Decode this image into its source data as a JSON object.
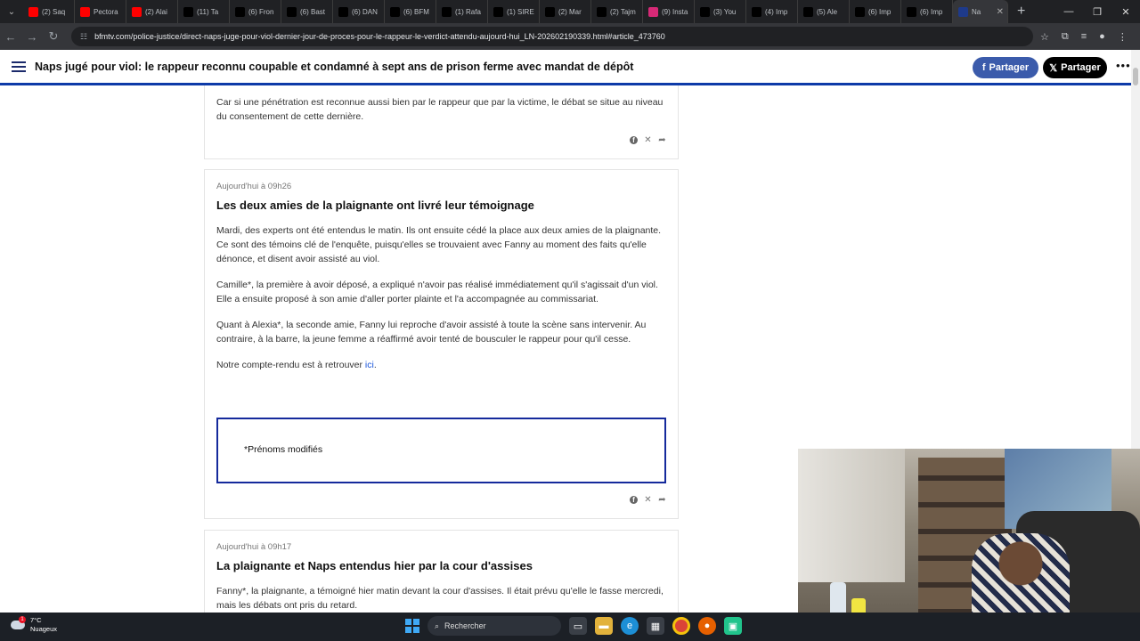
{
  "browser": {
    "tabs": [
      {
        "label": "(2) Saq",
        "color": "#ff0000",
        "icon": "youtube-icon"
      },
      {
        "label": "Pectora",
        "color": "#ff0000",
        "icon": "youtube-icon"
      },
      {
        "label": "(2) Alai",
        "color": "#ff0000",
        "icon": "youtube-icon"
      },
      {
        "label": "(11) Ta",
        "color": "#000000",
        "icon": "x-icon"
      },
      {
        "label": "(6) Fron",
        "color": "#000000",
        "icon": "x-icon"
      },
      {
        "label": "(6) Bast",
        "color": "#000000",
        "icon": "x-icon"
      },
      {
        "label": "(6) DAN",
        "color": "#000000",
        "icon": "x-icon"
      },
      {
        "label": "(6) BFM",
        "color": "#000000",
        "icon": "x-icon"
      },
      {
        "label": "(1) Rafa",
        "color": "#000000",
        "icon": "x-icon"
      },
      {
        "label": "(1) SIRE",
        "color": "#000000",
        "icon": "x-icon"
      },
      {
        "label": "(2) Mar",
        "color": "#000000",
        "icon": "x-icon"
      },
      {
        "label": "(2) Tajm",
        "color": "#000000",
        "icon": "x-icon"
      },
      {
        "label": "(9) Insta",
        "color": "#d62976",
        "icon": "instagram-icon"
      },
      {
        "label": "(3) You",
        "color": "#000000",
        "icon": "x-icon"
      },
      {
        "label": "(4) Imp",
        "color": "#000000",
        "icon": "x-icon"
      },
      {
        "label": "(5) Ale",
        "color": "#000000",
        "icon": "x-icon"
      },
      {
        "label": "(6) Imp",
        "color": "#000000",
        "icon": "x-icon"
      },
      {
        "label": "(6) Imp",
        "color": "#000000",
        "icon": "x-icon"
      },
      {
        "label": "Na",
        "color": "#1e3a8a",
        "icon": "bfm-icon",
        "active": true
      }
    ],
    "new_tab": "+",
    "url": "bfmtv.com/police-justice/direct-naps-juge-pour-viol-dernier-jour-de-proces-pour-le-rappeur-le-verdict-attendu-aujourd-hui_LN-202602190339.html#article_473760"
  },
  "site": {
    "headline": "Naps jugé pour viol: le rappeur reconnu coupable et condamné à sept ans de prison ferme avec mandat de dépôt",
    "share_facebook": "Partager",
    "share_x": "Partager",
    "accent": "#0d3aa8"
  },
  "cards": {
    "first": {
      "paragraph": "Car si une pénétration est reconnue aussi bien par le rappeur que par la victime, le débat se situe au niveau du consentement de cette dernière."
    },
    "second": {
      "time": "Aujourd'hui à 09h26",
      "title": "Les deux amies de la plaignante ont livré leur témoignage",
      "p1": "Mardi, des experts ont été entendus le matin. Ils ont ensuite cédé la place aux deux amies de la plaignante. Ce sont des témoins clé de l'enquête, puisqu'elles se trouvaient avec Fanny au moment des faits qu'elle dénonce, et disent avoir assisté au viol.",
      "p2": "Camille*, la première à avoir déposé, a expliqué n'avoir pas réalisé immédiatement qu'il s'agissait d'un viol. Elle a ensuite proposé à son amie d'aller porter plainte et l'a accompagnée au commissariat.",
      "p3": "Quant à Alexia*, la seconde amie, Fanny lui reproche d'avoir assisté à toute la scène sans intervenir. Au contraire, à la barre, la jeune femme a réaffirmé avoir tenté de bousculer le rappeur pour qu'il cesse.",
      "p4_prefix": "Notre compte-rendu est à retrouver ",
      "p4_link": "ici",
      "p4_suffix": ".",
      "note": "*Prénoms modifiés"
    },
    "third": {
      "time": "Aujourd'hui à 09h17",
      "title": "La plaignante et Naps entendus hier par la cour d'assises",
      "paragraph": "Fanny*, la plaignante, a témoigné hier matin devant la cour d'assises. Il était prévu qu'elle le fasse mercredi, mais les débats ont pris du retard."
    }
  },
  "taskbar": {
    "temperature": "7°C",
    "weather": "Nuageux",
    "weather_badge": "1",
    "search_placeholder": "Rechercher"
  }
}
